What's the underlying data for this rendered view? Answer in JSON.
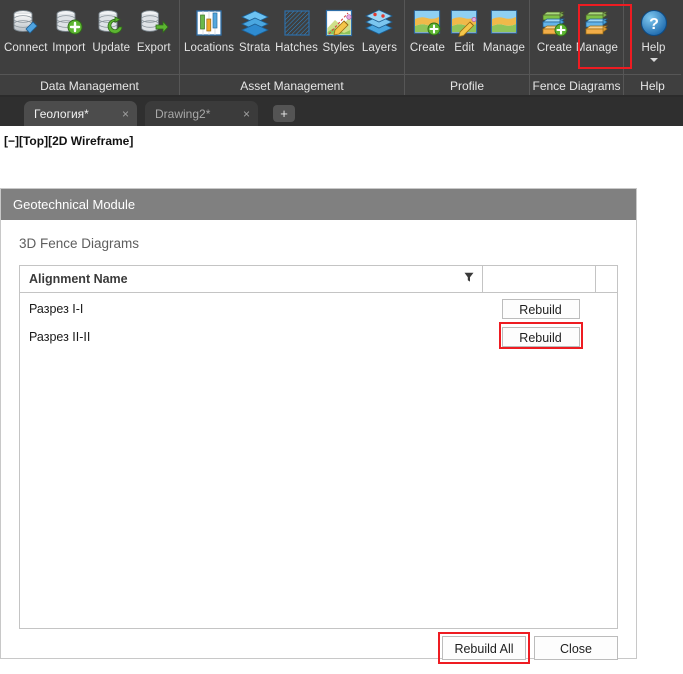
{
  "ribbon": {
    "groups": [
      {
        "title": "Data Management",
        "items": [
          {
            "label": "Connect",
            "icon": "database-connect-icon"
          },
          {
            "label": "Import",
            "icon": "database-import-icon"
          },
          {
            "label": "Update",
            "icon": "database-update-icon"
          },
          {
            "label": "Export",
            "icon": "database-export-icon"
          }
        ]
      },
      {
        "title": "Asset Management",
        "items": [
          {
            "label": "Locations",
            "icon": "borehole-locations-icon"
          },
          {
            "label": "Strata",
            "icon": "strata-layers-icon"
          },
          {
            "label": "Hatches",
            "icon": "hatch-pattern-icon"
          },
          {
            "label": "Styles",
            "icon": "map-styles-pencil-icon"
          },
          {
            "label": "Layers",
            "icon": "map-layers-icon"
          }
        ]
      },
      {
        "title": "Profile",
        "items": [
          {
            "label": "Create",
            "icon": "profile-create-icon"
          },
          {
            "label": "Edit",
            "icon": "profile-edit-icon"
          },
          {
            "label": "Manage",
            "icon": "profile-manage-icon"
          }
        ]
      },
      {
        "title": "Fence Diagrams",
        "items": [
          {
            "label": "Create",
            "icon": "fence-create-icon"
          },
          {
            "label": "Manage",
            "icon": "fence-manage-icon"
          }
        ]
      },
      {
        "title": "Help",
        "items": [
          {
            "label": "Help",
            "icon": "help-question-icon"
          }
        ]
      }
    ]
  },
  "tabs": {
    "items": [
      {
        "label": "Геология*",
        "close": "×",
        "active": true
      },
      {
        "label": "Drawing2*",
        "close": "×",
        "active": false
      }
    ],
    "new_tab": "+"
  },
  "viewport": {
    "label": "[−][Top][2D Wireframe]"
  },
  "dialog": {
    "title": "Geotechnical Module",
    "section_label": "3D Fence Diagrams",
    "grid": {
      "headers": [
        "Alignment Name",
        "",
        ""
      ],
      "filter_icon": "filter-funnel-icon",
      "rows": [
        {
          "name": "Разрез I-I",
          "action": "Rebuild",
          "highlighted": false
        },
        {
          "name": "Разрез II-II",
          "action": "Rebuild",
          "highlighted": true
        }
      ]
    },
    "footer": {
      "rebuild_all": "Rebuild All",
      "close": "Close"
    }
  },
  "colors": {
    "ribbon_bg": "#3f3f3f",
    "dialog_header": "#808080",
    "highlight_red": "#ee1c22",
    "accent_blue": "#2e8bd0",
    "accent_green": "#5cb531"
  }
}
